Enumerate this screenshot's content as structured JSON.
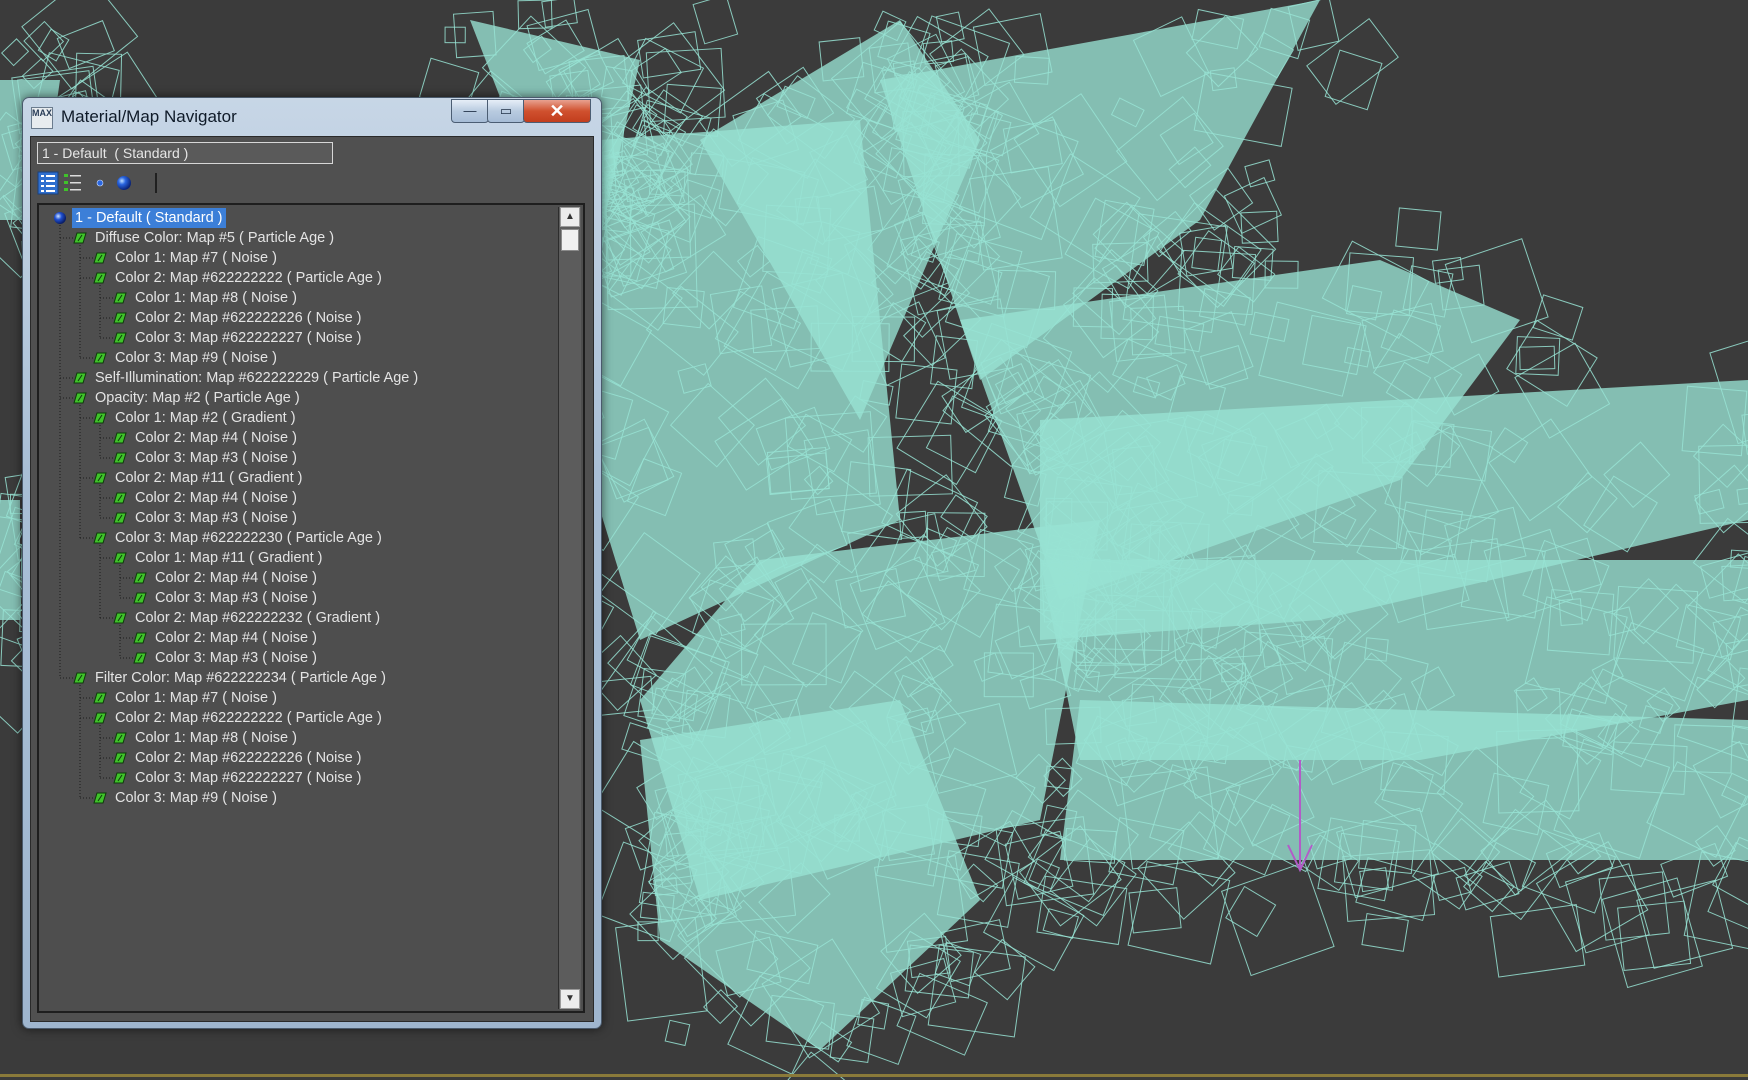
{
  "window": {
    "title": "Material/Map Navigator",
    "app_icon_text": "MAX",
    "minimize_glyph": "—",
    "maximize_glyph": "▭",
    "close_glyph": "✕"
  },
  "material_name_field": {
    "value": "1 - Default  ( Standard )"
  },
  "toolbar": {
    "buttons": [
      {
        "name": "view-list-icon"
      },
      {
        "name": "view-list-icons-icon"
      },
      {
        "name": "view-small-icons-icon"
      },
      {
        "name": "view-large-icons-icon"
      }
    ]
  },
  "tree": {
    "items": [
      {
        "label": "1 - Default  ( Standard )",
        "depth": 0,
        "icon": "material-sphere-icon",
        "selected": true
      },
      {
        "label": "Diffuse Color: Map #5  ( Particle Age )",
        "depth": 1,
        "icon": "map-parallelogram-icon"
      },
      {
        "label": "Color 1: Map #7  ( Noise )",
        "depth": 2,
        "icon": "map-parallelogram-icon"
      },
      {
        "label": "Color 2: Map #622222222  ( Particle Age )",
        "depth": 2,
        "icon": "map-parallelogram-icon"
      },
      {
        "label": "Color 1: Map #8  ( Noise )",
        "depth": 3,
        "icon": "map-parallelogram-icon"
      },
      {
        "label": "Color 2: Map #622222226  ( Noise )",
        "depth": 3,
        "icon": "map-parallelogram-icon"
      },
      {
        "label": "Color 3: Map #622222227  ( Noise )",
        "depth": 3,
        "icon": "map-parallelogram-icon"
      },
      {
        "label": "Color 3: Map #9  ( Noise )",
        "depth": 2,
        "icon": "map-parallelogram-icon"
      },
      {
        "label": "Self-Illumination: Map #622222229  ( Particle Age )",
        "depth": 1,
        "icon": "map-parallelogram-icon"
      },
      {
        "label": "Opacity: Map #2  ( Particle Age )",
        "depth": 1,
        "icon": "map-parallelogram-icon"
      },
      {
        "label": "Color 1: Map #2  ( Gradient )",
        "depth": 2,
        "icon": "map-parallelogram-icon"
      },
      {
        "label": "Color 2: Map #4  ( Noise )",
        "depth": 3,
        "icon": "map-parallelogram-icon"
      },
      {
        "label": "Color 3: Map #3  ( Noise )",
        "depth": 3,
        "icon": "map-parallelogram-icon"
      },
      {
        "label": "Color 2: Map #11  ( Gradient )",
        "depth": 2,
        "icon": "map-parallelogram-icon"
      },
      {
        "label": "Color 2: Map #4  ( Noise )",
        "depth": 3,
        "icon": "map-parallelogram-icon"
      },
      {
        "label": "Color 3: Map #3  ( Noise )",
        "depth": 3,
        "icon": "map-parallelogram-icon"
      },
      {
        "label": "Color 3: Map #622222230  ( Particle Age )",
        "depth": 2,
        "icon": "map-parallelogram-icon"
      },
      {
        "label": "Color 1: Map #11  ( Gradient )",
        "depth": 3,
        "icon": "map-parallelogram-icon"
      },
      {
        "label": "Color 2: Map #4  ( Noise )",
        "depth": 4,
        "icon": "map-parallelogram-icon"
      },
      {
        "label": "Color 3: Map #3  ( Noise )",
        "depth": 4,
        "icon": "map-parallelogram-icon"
      },
      {
        "label": "Color 2: Map #622222232  ( Gradient )",
        "depth": 3,
        "icon": "map-parallelogram-icon"
      },
      {
        "label": "Color 2: Map #4  ( Noise )",
        "depth": 4,
        "icon": "map-parallelogram-icon"
      },
      {
        "label": "Color 3: Map #3  ( Noise )",
        "depth": 4,
        "icon": "map-parallelogram-icon"
      },
      {
        "label": "Filter Color: Map #622222234  ( Particle Age )",
        "depth": 1,
        "icon": "map-parallelogram-icon"
      },
      {
        "label": "Color 1: Map #7  ( Noise )",
        "depth": 2,
        "icon": "map-parallelogram-icon"
      },
      {
        "label": "Color 2: Map #622222222  ( Particle Age )",
        "depth": 2,
        "icon": "map-parallelogram-icon"
      },
      {
        "label": "Color 1: Map #8  ( Noise )",
        "depth": 3,
        "icon": "map-parallelogram-icon"
      },
      {
        "label": "Color 2: Map #622222226  ( Noise )",
        "depth": 3,
        "icon": "map-parallelogram-icon"
      },
      {
        "label": "Color 3: Map #622222227  ( Noise )",
        "depth": 3,
        "icon": "map-parallelogram-icon"
      },
      {
        "label": "Color 3: Map #9  ( Noise )",
        "depth": 2,
        "icon": "map-parallelogram-icon"
      }
    ]
  },
  "scrollbar": {
    "up_glyph": "▲",
    "down_glyph": "▼"
  },
  "colors": {
    "viewport_background": "#3b3b3b",
    "particle_wireframe": "#98e3d4",
    "selection_highlight": "#3c7fd8",
    "map_icon_green": "#3fc22a",
    "material_sphere_blue": "#1f4fd0",
    "gizmo_magenta": "#b25cc8"
  }
}
